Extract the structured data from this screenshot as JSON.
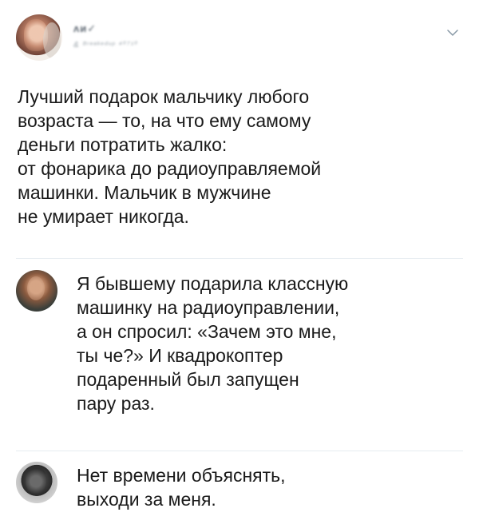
{
  "tweet": {
    "author": {
      "avatar_icon": "user-avatar-icon",
      "name": "ᴧᴎ✓",
      "handle": "& ᴮʳᵉᵃᵏᵉᵈᵘᵖ ⁴⁰⁷¹⁰"
    },
    "menu_icon": "chevron-down-icon",
    "text": "Лучший подарок мальчику любого\nвозраста — то, на что ему самому\nденьги потратить жалко:\nот фонарика до радиоуправляемой\nмашинки. Мальчик в мужчине\nне умирает никогда."
  },
  "replies": [
    {
      "avatar_icon": "user-avatar-icon",
      "text": "Я бывшему подарила классную\nмашинку на радиоуправлении,\nа он спросил: «Зачем это мне,\nты че?» И квадрокоптер\nподаренный был запущен\nпару раз."
    },
    {
      "avatar_icon": "user-avatar-icon",
      "text": "Нет времени объяснять,\nвыходи за меня."
    }
  ],
  "colors": {
    "text": "#1a1a1a",
    "muted": "#9aa3aa",
    "divider": "#e6ecf0"
  }
}
